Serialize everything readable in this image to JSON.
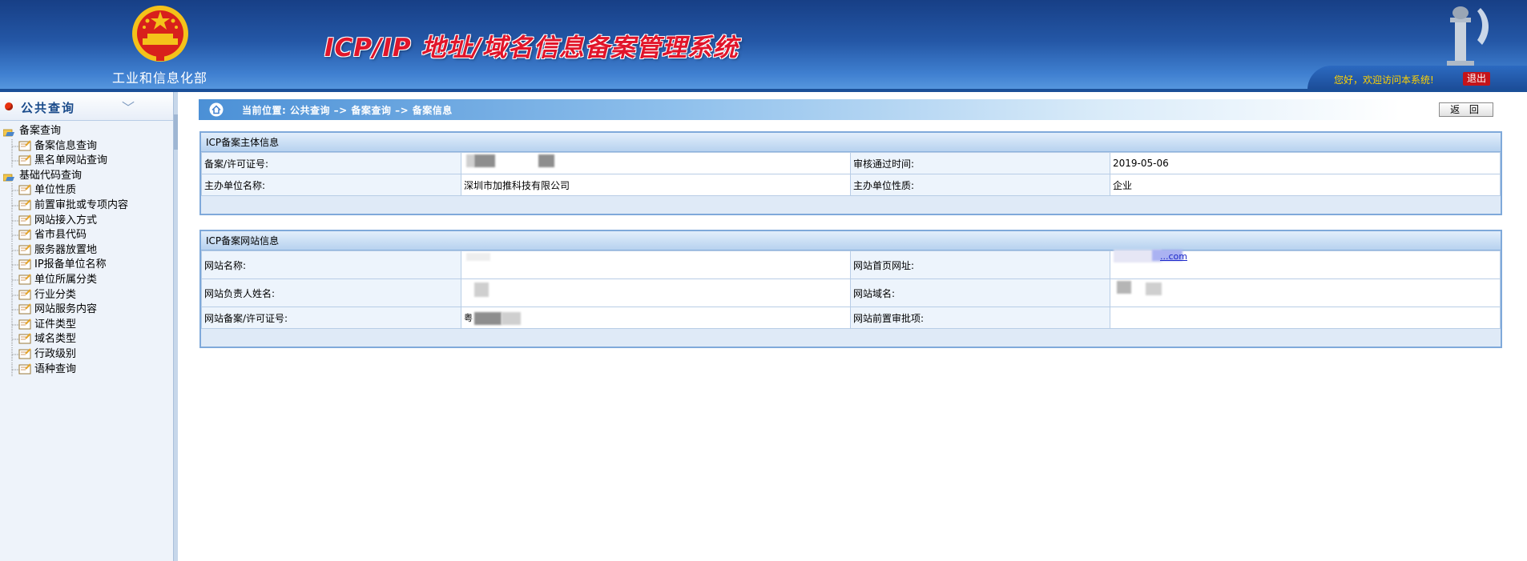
{
  "header": {
    "ministry": "工业和信息化部",
    "system_title": "ICP/IP 地址/域名信息备案管理系统",
    "welcome": "您好，欢迎访问本系统!",
    "logout": "退出"
  },
  "sidebar": {
    "title": "公共查询",
    "groups": [
      {
        "label": "备案查询",
        "items": [
          "备案信息查询",
          "黑名单网站查询"
        ]
      },
      {
        "label": "基础代码查询",
        "items": [
          "单位性质",
          "前置审批或专项内容",
          "网站接入方式",
          "省市县代码",
          "服务器放置地",
          "IP报备单位名称",
          "单位所属分类",
          "行业分类",
          "网站服务内容",
          "证件类型",
          "域名类型",
          "行政级别",
          "语种查询"
        ]
      }
    ]
  },
  "breadcrumb": "当前位置: 公共查询 –> 备案查询 –> 备案信息",
  "back_button": "返 回",
  "subject_panel": {
    "title": "ICP备案主体信息",
    "license_label": "备案/许可证号:",
    "license_value": "",
    "approval_time_label": "审核通过时间:",
    "approval_time_value": "2019-05-06",
    "org_name_label": "主办单位名称:",
    "org_name_value": "深圳市加推科技有限公司",
    "org_nature_label": "主办单位性质:",
    "org_nature_value": "企业"
  },
  "website_panel": {
    "title": "ICP备案网站信息",
    "site_name_label": "网站名称:",
    "homepage_label": "网站首页网址:",
    "homepage_value": "...com",
    "owner_label": "网站负责人姓名:",
    "domain_label": "网站域名:",
    "site_license_label": "网站备案/许可证号:",
    "site_license_value": "粤",
    "pre_approval_label": "网站前置审批项:"
  },
  "colors": {
    "header_blue": "#2457a6",
    "title_red": "#e1152a",
    "welcome_yellow": "#ffd200",
    "panel_border": "#7fa9da"
  }
}
